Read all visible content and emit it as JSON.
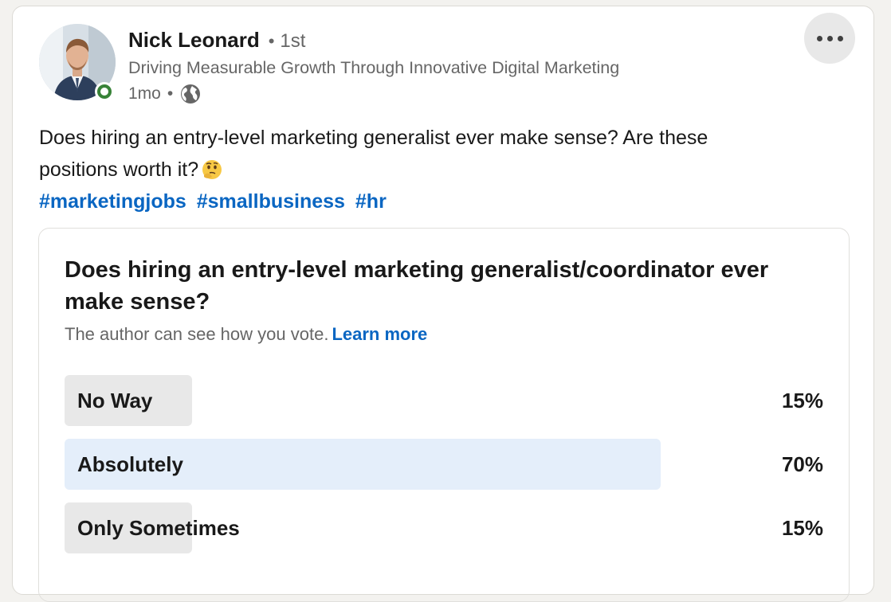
{
  "author": {
    "name": "Nick Leonard",
    "connection_degree": "1st",
    "headline": "Driving Measurable Growth Through Innovative Digital Marketing",
    "post_age": "1mo",
    "visibility_icon": "globe-icon",
    "online_status": "online"
  },
  "post": {
    "text_line1": "Does hiring an entry-level marketing generalist ever make sense? Are these",
    "text_line2": "positions worth it?",
    "emoji": "thinking-face",
    "hashtags": [
      "#marketingjobs",
      "#smallbusiness",
      "#hr"
    ]
  },
  "poll": {
    "question": "Does hiring an entry-level marketing generalist/coordinator ever make sense?",
    "visibility_note": "The author can see how you vote.",
    "learn_more_label": "Learn more",
    "options": [
      {
        "label": "No Way",
        "percent_label": "15%",
        "percent": 15,
        "selected": false
      },
      {
        "label": "Absolutely",
        "percent_label": "70%",
        "percent": 70,
        "selected": true
      },
      {
        "label": "Only Sometimes",
        "percent_label": "15%",
        "percent": 15,
        "selected": false
      }
    ]
  },
  "colors": {
    "link_blue": "#0a66c2",
    "online_green": "#378237",
    "selected_bar": "#e4eefa",
    "result_bar": "#e8e8e8"
  }
}
